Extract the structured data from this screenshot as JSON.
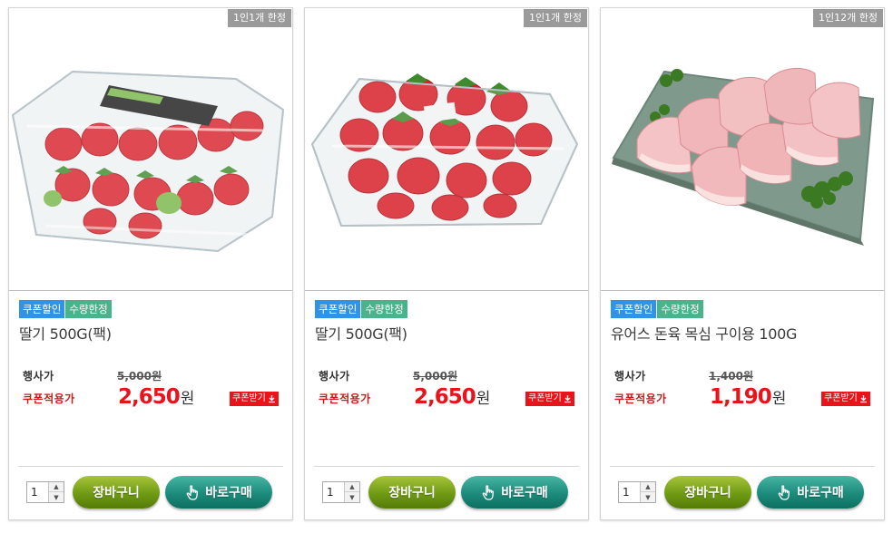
{
  "products": [
    {
      "limit_badge": "1인1개 한정",
      "tags": [
        "쿠폰할인",
        "수량한정"
      ],
      "name": "딸기 500G(팩)",
      "price_label": "행사가",
      "original_price": "5,000원",
      "coupon_label": "쿠폰적용가",
      "sale_price": "2,650",
      "sale_unit": "원",
      "coupon_button": "쿠폰받기",
      "quantity": "1",
      "cart_button": "장바구니",
      "buy_button": "바로구매",
      "image_icon": "strawberry-pack-photo"
    },
    {
      "limit_badge": "1인1개 한정",
      "tags": [
        "쿠폰할인",
        "수량한정"
      ],
      "name": "딸기 500G(팩)",
      "price_label": "행사가",
      "original_price": "5,000원",
      "coupon_label": "쿠폰적용가",
      "sale_price": "2,650",
      "sale_unit": "원",
      "coupon_button": "쿠폰받기",
      "quantity": "1",
      "cart_button": "장바구니",
      "buy_button": "바로구매",
      "image_icon": "strawberry-pack-photo"
    },
    {
      "limit_badge": "1인12개 한정",
      "tags": [
        "쿠폰할인",
        "수량한정"
      ],
      "name": "유어스 돈육 목심 구이용 100G",
      "price_label": "행사가",
      "original_price": "1,400원",
      "coupon_label": "쿠폰적용가",
      "sale_price": "1,190",
      "sale_unit": "원",
      "coupon_button": "쿠폰받기",
      "quantity": "1",
      "cart_button": "장바구니",
      "buy_button": "바로구매",
      "image_icon": "pork-neck-photo"
    }
  ],
  "colors": {
    "coupon_tag": "#2f93e8",
    "limited_tag": "#4bb38c",
    "sale_price": "#e8141a",
    "cart_button": "#6f9a14",
    "buy_button": "#1d8b7b"
  }
}
